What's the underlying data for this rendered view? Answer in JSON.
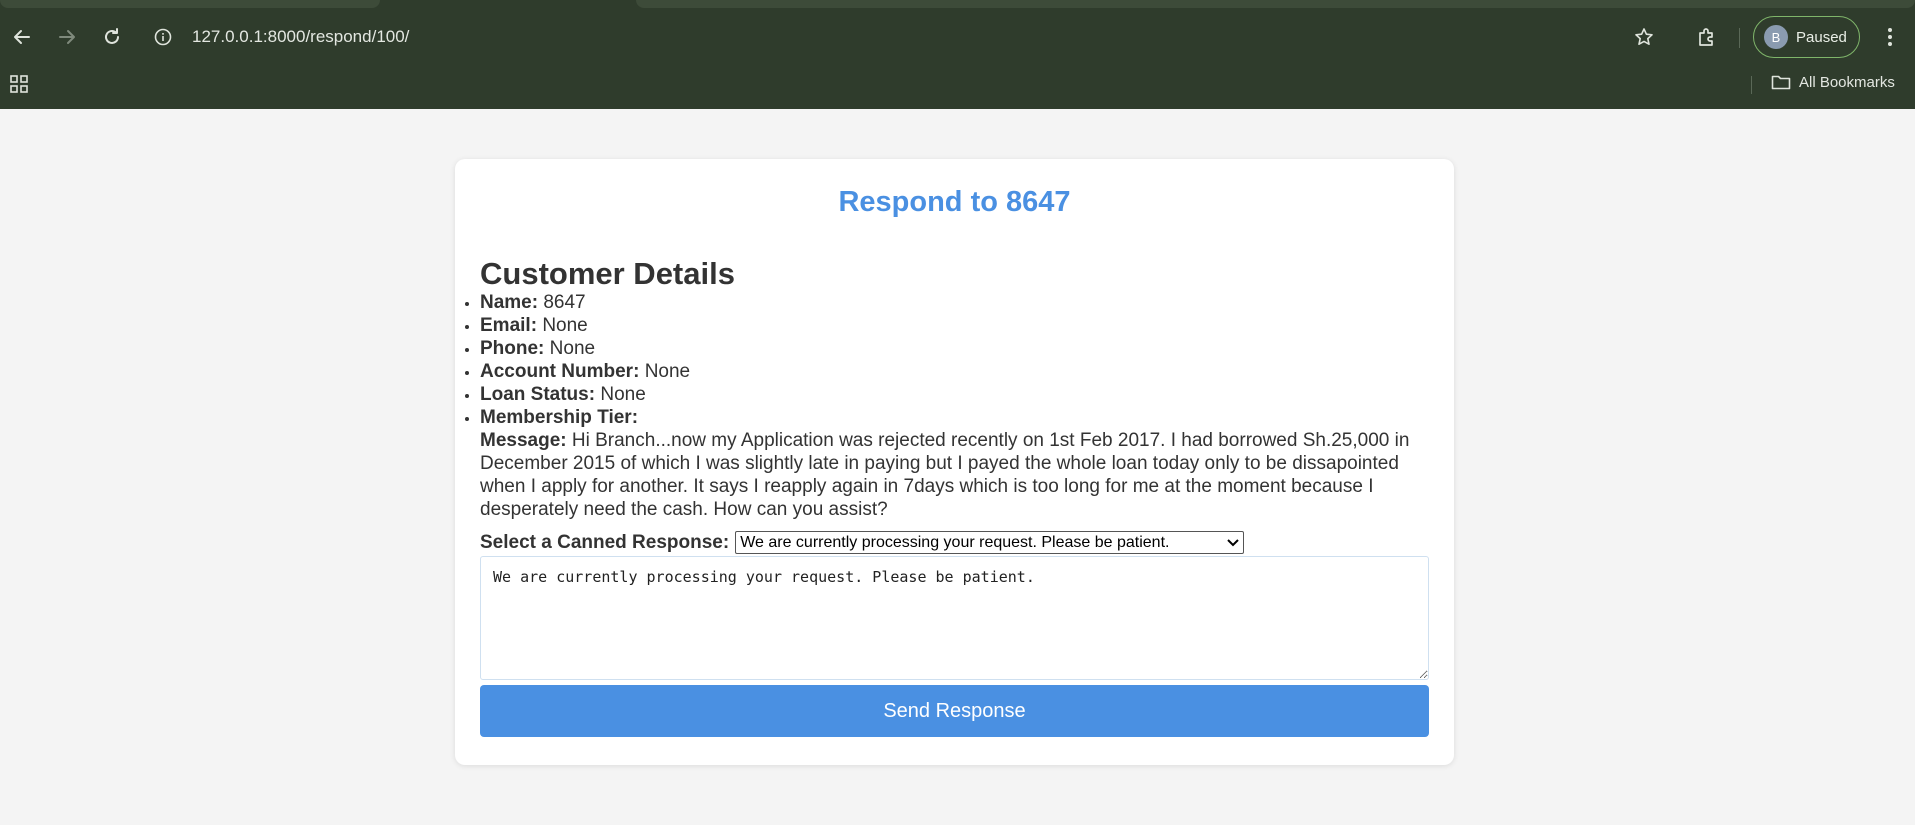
{
  "browser": {
    "url": "127.0.0.1:8000/respond/100/",
    "profile_initial": "B",
    "profile_status": "Paused",
    "all_bookmarks_label": "All Bookmarks"
  },
  "page": {
    "title": "Respond to 8647",
    "section_title": "Customer Details",
    "details": [
      {
        "label": "Name:",
        "value": "8647"
      },
      {
        "label": "Email:",
        "value": "None"
      },
      {
        "label": "Phone:",
        "value": "None"
      },
      {
        "label": "Account Number:",
        "value": "None"
      },
      {
        "label": "Loan Status:",
        "value": "None"
      },
      {
        "label": "Membership Tier:",
        "value": ""
      }
    ],
    "message_label": "Message:",
    "message_text": "Hi Branch...now my Application was rejected recently on 1st Feb 2017. I had borrowed Sh.25,000 in December 2015 of which I was slightly late in paying but I payed the whole loan today only to be dissapointed when I apply for another. It says I reapply again in 7days which is too long for me at the moment because I desperately need the cash. How can you assist?",
    "canned_label": "Select a Canned Response:",
    "canned_selected": "We are currently processing your request. Please be patient.",
    "response_text": "We are currently processing your request. Please be patient.",
    "send_label": "Send Response"
  },
  "colors": {
    "accent": "#4a90e2",
    "chrome_bg": "#2f3c2c",
    "page_bg": "#f4f4f4"
  }
}
